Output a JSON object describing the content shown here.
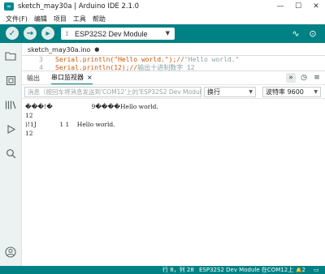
{
  "window": {
    "title": "sketch_may30a | Arduino IDE 2.1.0",
    "controls": [
      "—",
      "☐",
      "✕"
    ]
  },
  "menu": [
    "文件(F)",
    "编辑",
    "项目",
    "工具",
    "帮助"
  ],
  "toolbar": {
    "verify_icon": "✓",
    "upload_icon": "→",
    "debug_icon": "▸",
    "board": "ESP32S2 Dev Module",
    "board_caret": "▼",
    "usb_icon": "⟟",
    "plotter_icon": "∿",
    "monitor_icon": "⊙"
  },
  "activity_icons": [
    "folder-icon",
    "boards-manager-icon",
    "library-icon",
    "debug-icon",
    "search-icon",
    "account-icon"
  ],
  "editor": {
    "tab": "sketch_may30a.ino",
    "modified_dot": "●",
    "lines": [
      {
        "num": "3",
        "code": "Serial.println(\"Hello world.\");//",
        "comment": "\"Hello world.\""
      },
      {
        "num": "4",
        "code": "Serial.println(12);//",
        "comment": "输出十进制数字 12"
      }
    ]
  },
  "panel": {
    "tabs": [
      "输出",
      "串口监视器"
    ],
    "active_tab": "串口监视器",
    "close": "×",
    "autoscroll_icon": "»",
    "timestamp_icon": "◷",
    "clear_icon": "≡"
  },
  "monitor": {
    "input_placeholder": "消息（按回车将消息发送到'COM12'上的'ESP32S2 Dev Module'）",
    "line_ending": "换行",
    "baud_rate": "波特率 9600"
  },
  "output_lines": [
    "���!�                    9����Hello world.",
    "12",
    ")!1J            1 1    Hello world.",
    "12"
  ],
  "status": {
    "position": "行 8，列 28",
    "board": "ESP32S2 Dev Module 在COM12上",
    "notifications": "2",
    "bell_icon": "🔔",
    "layout_icon": "▭"
  },
  "colors": {
    "accent": "#008184",
    "status_bar": "#008184"
  }
}
